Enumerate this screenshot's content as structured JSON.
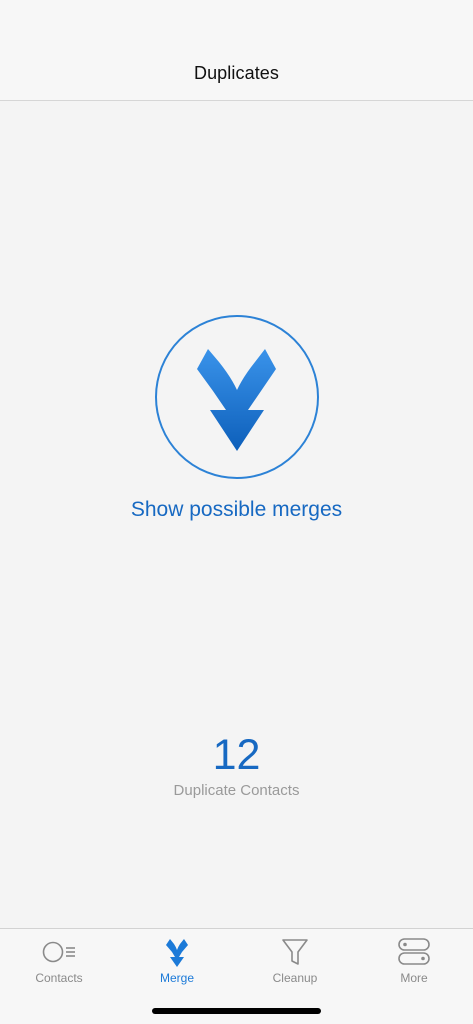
{
  "nav": {
    "title": "Duplicates"
  },
  "main": {
    "merge_icon": "merge-arrows-icon",
    "action_label": "Show possible merges",
    "duplicate_count": "12",
    "duplicate_label": "Duplicate Contacts"
  },
  "tabs": [
    {
      "label": "Contacts",
      "icon": "contacts-icon",
      "active": false
    },
    {
      "label": "Merge",
      "icon": "merge-icon",
      "active": true
    },
    {
      "label": "Cleanup",
      "icon": "filter-icon",
      "active": false
    },
    {
      "label": "More",
      "icon": "more-toggles-icon",
      "active": false
    }
  ],
  "colors": {
    "accent": "#1769c2",
    "tab_active": "#1c7ad8",
    "tab_inactive": "#8a8a8a",
    "background": "#f4f4f4"
  }
}
